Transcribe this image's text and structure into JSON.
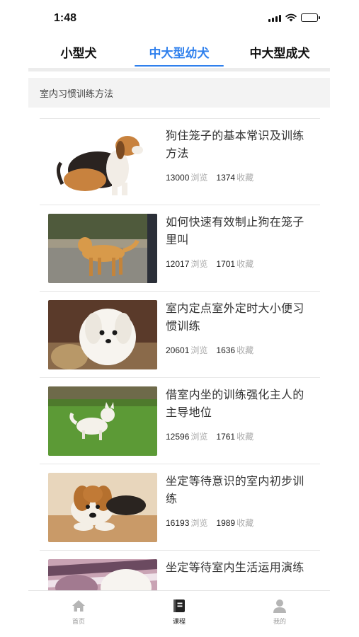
{
  "status_bar": {
    "time": "1:48"
  },
  "tabs": [
    {
      "label": "小型犬",
      "active": false
    },
    {
      "label": "中大型幼犬",
      "active": true
    },
    {
      "label": "中大型成犬",
      "active": false
    }
  ],
  "section": {
    "title": "室内习惯训练方法"
  },
  "articles": [
    {
      "title": "狗住笼子的基本常识及训练方法",
      "views": "13000",
      "views_unit": "浏览",
      "favorites": "1374",
      "favorites_unit": "收藏",
      "image": "beagle-sitting-photo"
    },
    {
      "title": "如何快速有效制止狗在笼子里叫",
      "views": "12017",
      "views_unit": "浏览",
      "favorites": "1701",
      "favorites_unit": "收藏",
      "image": "golden-retriever-street-photo"
    },
    {
      "title": "室内定点室外定时大小便习惯训练",
      "views": "20601",
      "views_unit": "浏览",
      "favorites": "1636",
      "favorites_unit": "收藏",
      "image": "white-puppy-basket-photo"
    },
    {
      "title": "借室内坐的训练强化主人的主导地位",
      "views": "12596",
      "views_unit": "浏览",
      "favorites": "1761",
      "favorites_unit": "收藏",
      "image": "white-puppy-grass-photo"
    },
    {
      "title": "坐定等待意识的室内初步训练",
      "views": "16193",
      "views_unit": "浏览",
      "favorites": "1989",
      "favorites_unit": "收藏",
      "image": "beagle-puppy-lying-photo"
    },
    {
      "title": "坐定等待室内生活运用演练",
      "views": "",
      "views_unit": "",
      "favorites": "",
      "favorites_unit": "",
      "image": "puppy-blanket-photo"
    }
  ],
  "bottom_nav": [
    {
      "label": "首页",
      "icon": "home-icon",
      "active": false
    },
    {
      "label": "课程",
      "icon": "book-icon",
      "active": true
    },
    {
      "label": "我的",
      "icon": "person-icon",
      "active": false
    }
  ],
  "colors": {
    "accent": "#2f80ed",
    "muted": "#aaaaaa",
    "divider": "#e6e6e6"
  }
}
